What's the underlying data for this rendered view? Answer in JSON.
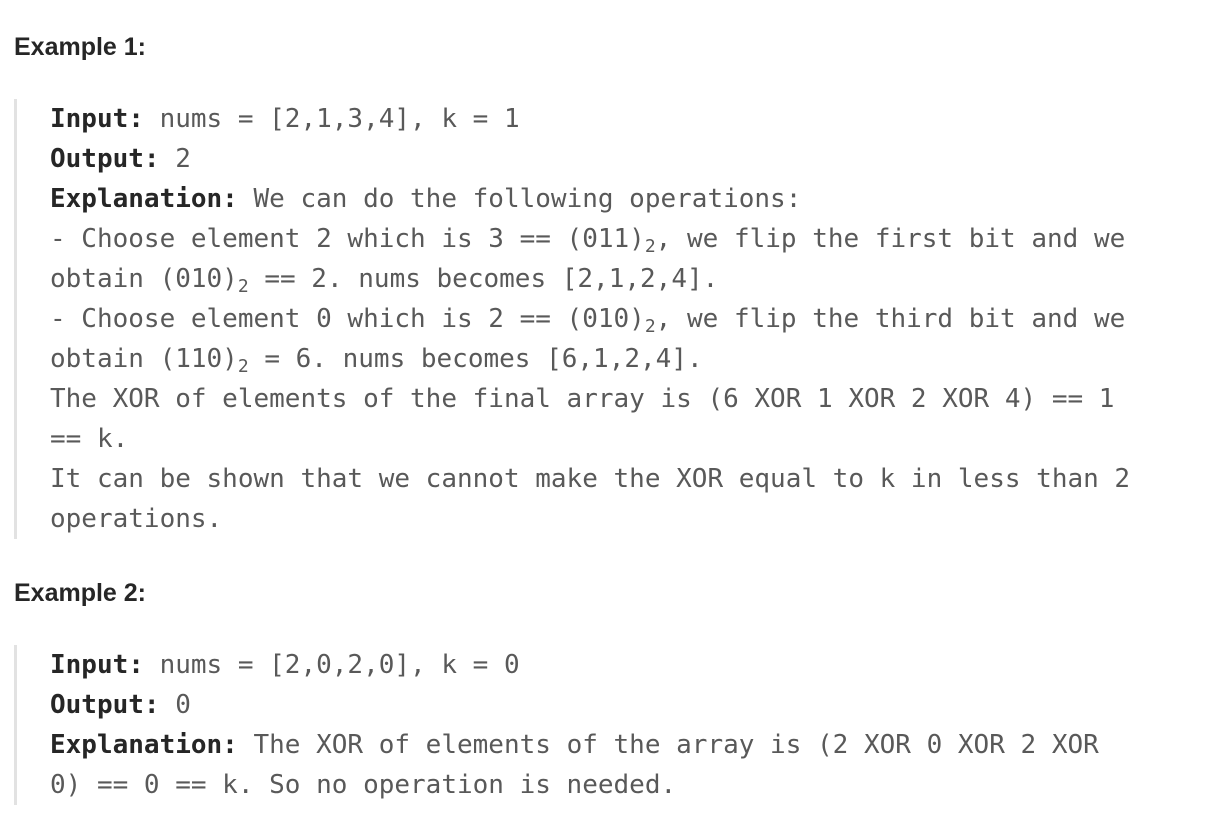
{
  "example1": {
    "heading": "Example 1:",
    "input_label": "Input:",
    "input_value": " nums = [2,1,3,4], k = 1",
    "output_label": "Output:",
    "output_value": " 2",
    "explanation_label": "Explanation:",
    "explanation_value": " We can do the following operations:",
    "lines": {
      "l1_pre": "- Choose element 2 which is 3 == (011)",
      "l1_sub": "2",
      "l1_post": ", we flip the first bit and we",
      "l2_pre": "obtain (010)",
      "l2_sub": "2",
      "l2_post": " == 2. nums becomes [2,1,2,4].",
      "l3_pre": "- Choose element 0 which is 2 == (010)",
      "l3_sub": "2",
      "l3_post": ", we flip the third bit and we",
      "l4_pre": "obtain (110)",
      "l4_sub": "2",
      "l4_post": " = 6. nums becomes [6,1,2,4].",
      "l5": "The XOR of elements of the final array is (6 XOR 1 XOR 2 XOR 4) == 1",
      "l6": "== k.",
      "l7": "It can be shown that we cannot make the XOR equal to k in less than 2",
      "l8": "operations."
    }
  },
  "example2": {
    "heading": "Example 2:",
    "input_label": "Input:",
    "input_value": " nums = [2,0,2,0], k = 0",
    "output_label": "Output:",
    "output_value": " 0",
    "explanation_label": "Explanation:",
    "explanation_value": " The XOR of elements of the array is (2 XOR 0 XOR 2 XOR",
    "line2": "0) == 0 == k. So no operation is needed."
  }
}
